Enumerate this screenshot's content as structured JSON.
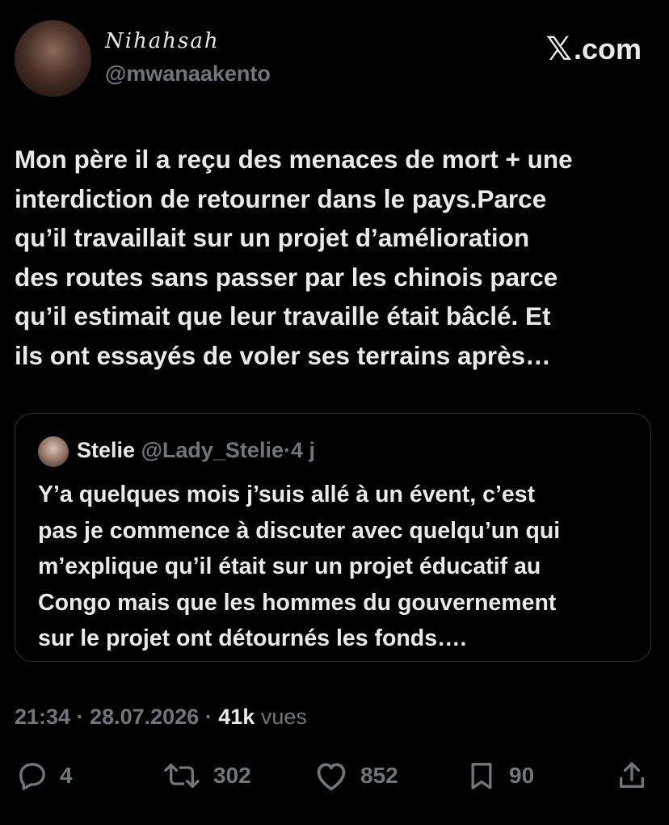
{
  "author": {
    "display_name": "Nihahsah",
    "handle": "@mwanaakento"
  },
  "brand": {
    "logo_glyph": "𝕏",
    "label": ".com"
  },
  "tweet": {
    "text": "Mon père il a reçu des menaces de mort + une\ninterdiction de retourner dans le pays.Parce\nqu’il travaillait sur un projet d’amélioration\ndes routes sans passer par les chinois parce\nqu’il estimait que leur travaille était bâclé. Et\nils ont essayés de voler ses terrains après…"
  },
  "quoted": {
    "name": "Stelie",
    "handle": "@Lady_Stelie",
    "separator": "·",
    "time": "4 j",
    "text": "Y’a quelques mois j’suis allé à un évent, c’est\npas je commence à discuter avec quelqu’un qui\nm’explique qu’il était sur un projet éducatif au\nCongo mais que les hommes du gouvernement\nsur le projet ont détournés les fonds…."
  },
  "meta": {
    "time": "21:34",
    "separator": "·",
    "date": "28.07.2026",
    "views_count": "41k",
    "views_label": "vues"
  },
  "actions": {
    "replies": "4",
    "retweets": "302",
    "likes": "852",
    "bookmarks": "90"
  },
  "icons": {
    "reply": "reply-icon",
    "retweet": "retweet-icon",
    "like": "heart-icon",
    "bookmark": "bookmark-icon",
    "share": "share-icon"
  },
  "colors": {
    "background": "#000000",
    "text": "#e7e9ea",
    "secondary": "#71767b",
    "border": "#2f3336"
  }
}
